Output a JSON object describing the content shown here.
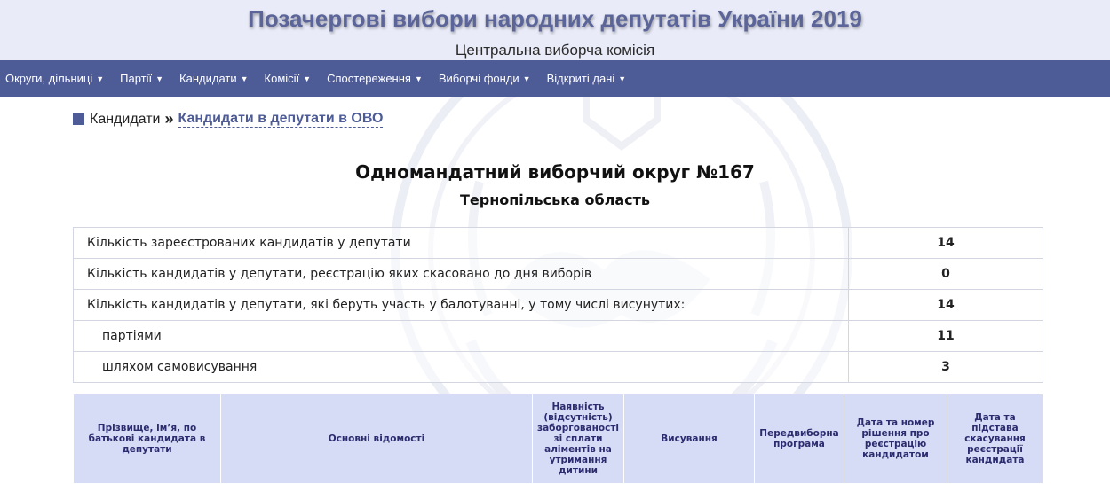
{
  "header": {
    "title": "Позачергові вибори народних депутатів України 2019",
    "subtitle": "Центральна виборча комісія"
  },
  "nav": {
    "items": [
      {
        "label": "Округи, дільниці"
      },
      {
        "label": "Партії"
      },
      {
        "label": "Кандидати"
      },
      {
        "label": "Комісії"
      },
      {
        "label": "Спостереження"
      },
      {
        "label": "Виборчі фонди"
      },
      {
        "label": "Відкриті дані"
      }
    ]
  },
  "breadcrumb": {
    "root": "Кандидати",
    "separator": "»",
    "current": "Кандидати в депутати в ОВО"
  },
  "district": {
    "title": "Одномандатний виборчий округ №167",
    "region": "Тернопільська область"
  },
  "stats": [
    {
      "label": "Кількість зареєстрованих кандидатів у депутати",
      "value": "14"
    },
    {
      "label": "Кількість кандидатів у депутати, реєстрацію яких скасовано до дня виборів",
      "value": "0"
    },
    {
      "label": "Кількість кандидатів у депутати, які беруть участь у балотуванні, у тому числі висунутих:",
      "value": "14"
    },
    {
      "label": "партіями",
      "value": "11"
    },
    {
      "label": "шляхом самовисування",
      "value": "3"
    }
  ],
  "table": {
    "headers": [
      "Прізвище, ім’я, по батькові кандидата в депутати",
      "Основні відомості",
      "Наявність (відсутність) заборгованості зі сплати аліментів на утримання дитини",
      "Висування",
      "Передвиборна програма",
      "Дата та номер рішення про реєстрацію кандидатом",
      "Дата та підстава скасування реєстрації кандидата"
    ]
  },
  "colors": {
    "nav_background": "#4d5b96",
    "header_background": "#e9ebf8",
    "title_color": "#5b6599",
    "table_header_background": "#d6dcf5",
    "table_header_text": "#2b2b6f"
  }
}
